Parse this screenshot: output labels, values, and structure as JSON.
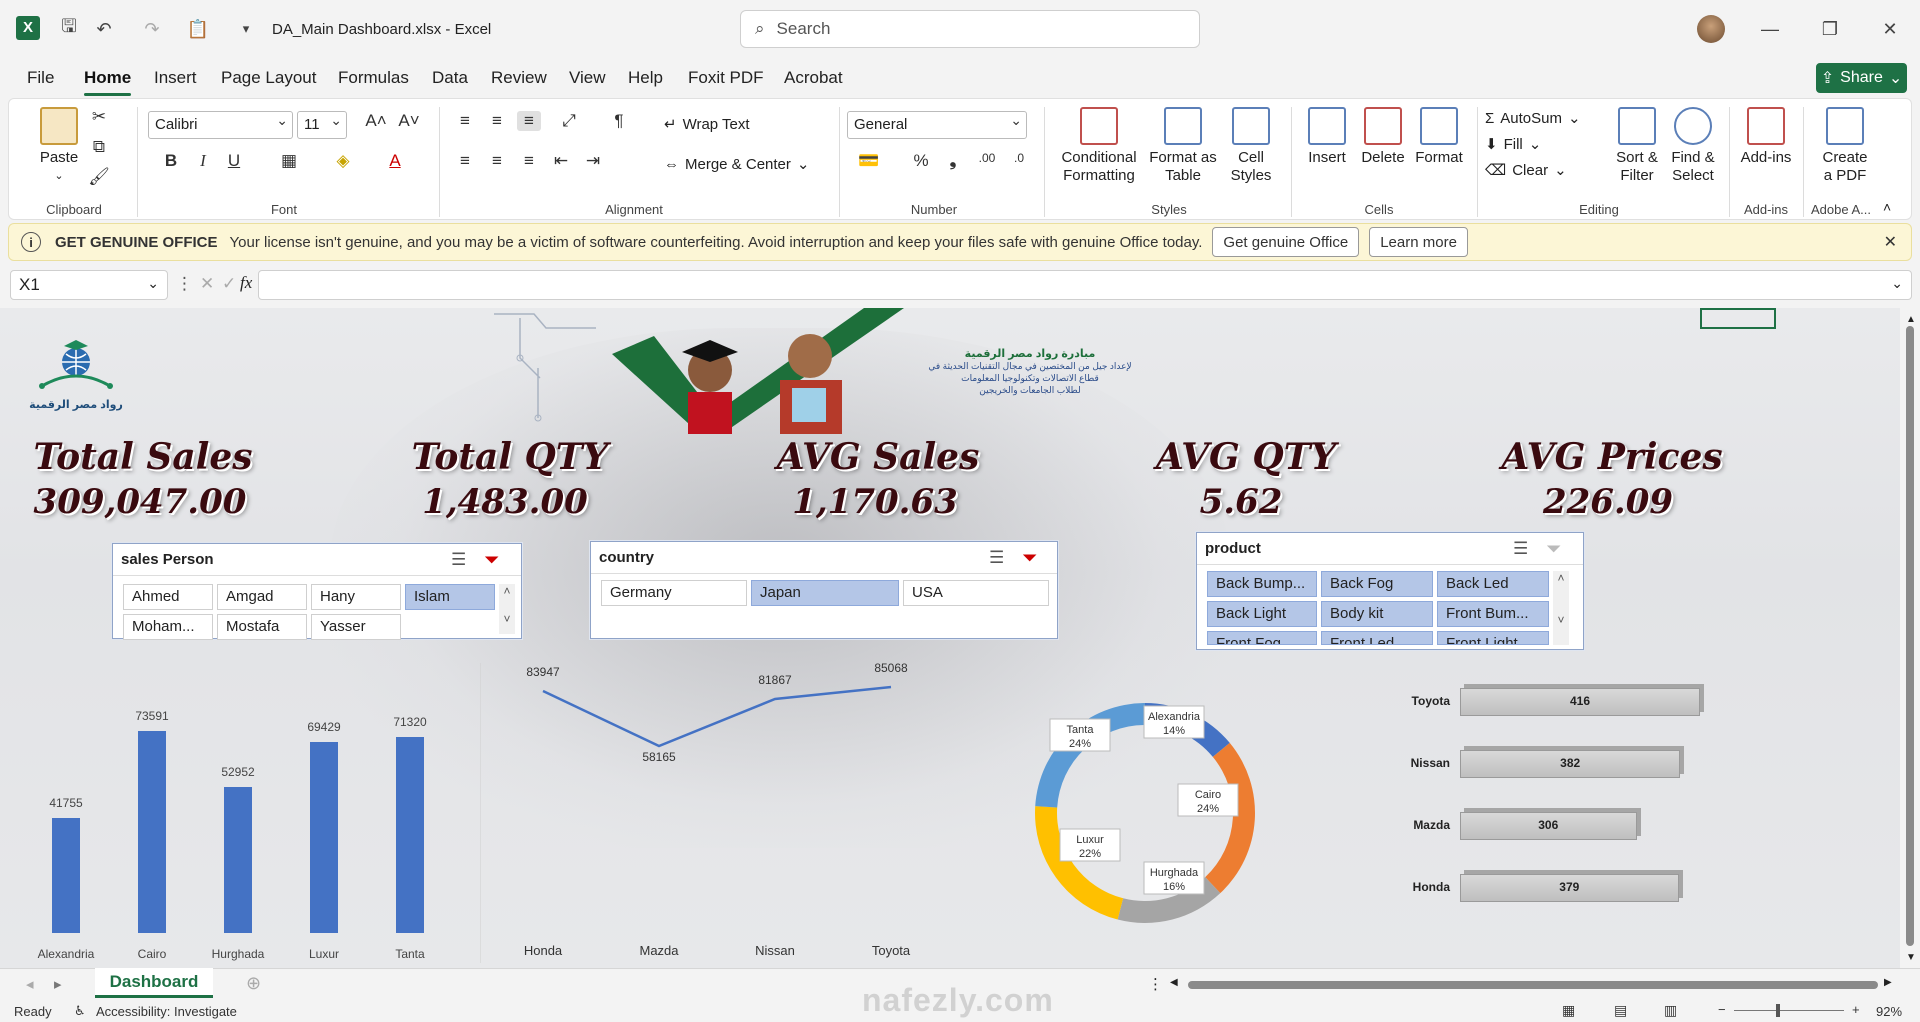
{
  "window": {
    "title": "DA_Main Dashboard.xlsx  -  Excel",
    "search_placeholder": "Search",
    "min": "—",
    "max": "❐",
    "close": "✕"
  },
  "menu": {
    "items": [
      "File",
      "Home",
      "Insert",
      "Page Layout",
      "Formulas",
      "Data",
      "Review",
      "View",
      "Help",
      "Foxit PDF",
      "Acrobat"
    ],
    "share": "Share"
  },
  "ribbon": {
    "clipboard": {
      "paste": "Paste",
      "label": "Clipboard"
    },
    "font": {
      "name": "Calibri",
      "size": "11",
      "label": "Font"
    },
    "alignment": {
      "wrap": "Wrap Text",
      "merge": "Merge & Center",
      "label": "Alignment"
    },
    "number": {
      "format": "General",
      "label": "Number"
    },
    "styles": {
      "cond1": "Conditional",
      "cond2": "Formatting",
      "table1": "Format as",
      "table2": "Table",
      "cell1": "Cell",
      "cell2": "Styles",
      "label": "Styles"
    },
    "cells": {
      "insert": "Insert",
      "delete": "Delete",
      "format": "Format",
      "label": "Cells"
    },
    "editing": {
      "autosum": "AutoSum",
      "fill": "Fill",
      "clear": "Clear",
      "sort1": "Sort &",
      "sort2": "Filter",
      "find1": "Find &",
      "find2": "Select",
      "label": "Editing"
    },
    "addins": {
      "btn": "Add-ins",
      "label": "Add-ins"
    },
    "adobe": {
      "btn1": "Create",
      "btn2": "a PDF",
      "label": "Adobe A..."
    }
  },
  "warning": {
    "title": "GET GENUINE OFFICE",
    "message": "Your license isn't genuine, and you may be a victim of software counterfeiting. Avoid interruption and keep your files safe with genuine Office today.",
    "btn1": "Get genuine Office",
    "btn2": "Learn more"
  },
  "formula": {
    "namebox": "X1",
    "value": ""
  },
  "logo_text": "رواد مصر الرقمية",
  "banner": {
    "line1": "مبادرة رواد مصر الرقمية",
    "line2": "لإعداد جيل من المختصين في مجال التقنيات الحديثة في",
    "line3": "قطاع الاتصالات وتكنولوجيا المعلومات",
    "line4": "لطلاب الجامعات والخريجين"
  },
  "kpis": [
    {
      "title": "Total Sales",
      "value": "309,047.00"
    },
    {
      "title": "Total QTY",
      "value": "1,483.00"
    },
    {
      "title": "AVG Sales",
      "value": "1,170.63"
    },
    {
      "title": "AVG QTY",
      "value": "5.62"
    },
    {
      "title": "AVG Prices",
      "value": "226.09"
    }
  ],
  "slicers": {
    "salesperson": {
      "title": "sales Person",
      "items": [
        "Ahmed",
        "Amgad",
        "Hany",
        "Islam",
        "Moham...",
        "Mostafa",
        "Yasser"
      ],
      "selected": "Islam"
    },
    "country": {
      "title": "country",
      "items": [
        "Germany",
        "Japan",
        "USA"
      ],
      "selected": "Japan"
    },
    "product": {
      "title": "product",
      "items": [
        "Back Bump...",
        "Back Fog",
        "Back Led",
        "Back Light",
        "Body kit",
        "Front Bum...",
        "Front Fog",
        "Front Led",
        "Front Light"
      ]
    }
  },
  "chart_data": [
    {
      "type": "bar",
      "categories": [
        "Alexandria",
        "Cairo",
        "Hurghada",
        "Luxur",
        "Tanta"
      ],
      "values": [
        41755,
        73591,
        52952,
        69429,
        71320
      ],
      "color": "#4472c4"
    },
    {
      "type": "line",
      "categories": [
        "Honda",
        "Mazda",
        "Nissan",
        "Toyota"
      ],
      "values": [
        83947,
        58165,
        81867,
        85068
      ],
      "color": "#4472c4"
    },
    {
      "type": "pie",
      "categories": [
        "Alexandria",
        "Cairo",
        "Hurghada",
        "Luxur",
        "Tanta"
      ],
      "values": [
        14,
        24,
        16,
        22,
        24
      ],
      "labels": [
        "Alexandria\n14%",
        "Cairo\n24%",
        "Hurghada\n16%",
        "Luxur\n22%",
        "Tanta\n24%"
      ],
      "colors": [
        "#4472c4",
        "#ed7d31",
        "#a5a5a5",
        "#ffc000",
        "#5b9bd5"
      ]
    },
    {
      "type": "bar",
      "orientation": "horizontal",
      "categories": [
        "Toyota",
        "Nissan",
        "Mazda",
        "Honda"
      ],
      "values": [
        416,
        382,
        306,
        379
      ]
    }
  ],
  "tabs": {
    "sheet": "Dashboard",
    "add": "⊕"
  },
  "status": {
    "ready": "Ready",
    "accessibility": "Accessibility: Investigate",
    "zoom": "92%"
  },
  "watermark": "nafezly.com"
}
